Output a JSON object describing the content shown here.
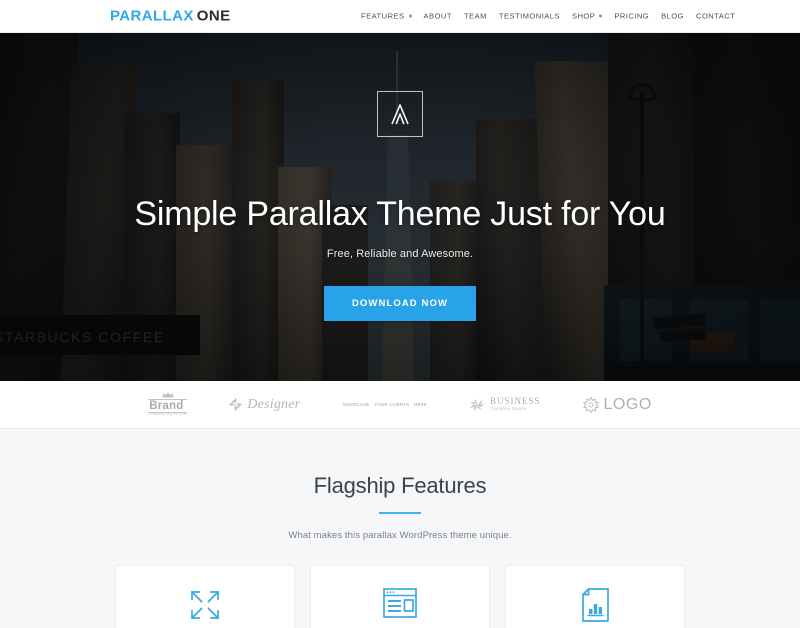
{
  "header": {
    "logo_primary": "PARALLAX",
    "logo_secondary": "ONE",
    "nav": [
      {
        "label": "FEATURES",
        "has_caret": true
      },
      {
        "label": "ABOUT",
        "has_caret": false
      },
      {
        "label": "TEAM",
        "has_caret": false
      },
      {
        "label": "TESTIMONIALS",
        "has_caret": false
      },
      {
        "label": "SHOP",
        "has_caret": true
      },
      {
        "label": "PRICING",
        "has_caret": false
      },
      {
        "label": "BLOG",
        "has_caret": false
      },
      {
        "label": "CONTACT",
        "has_caret": false
      }
    ]
  },
  "hero": {
    "badge_icon": "parallax-mark-icon",
    "title": "Simple Parallax Theme Just for You",
    "subtitle": "Free, Reliable and Awesome.",
    "button_label": "DOWNLOAD NOW",
    "button_color": "#28a3e8",
    "background_text": "STARBUCKS COFFEE"
  },
  "clients": [
    {
      "name": "Brand",
      "tagline": "Company tagline here",
      "icon": "crown-icon"
    },
    {
      "name": "Designer",
      "tagline": "",
      "icon": "flower-star-icon"
    },
    {
      "line1": "SHOWCASE",
      "line2": "YOUR CLIENTS",
      "line3": "HERE"
    },
    {
      "name": "BUSINESS",
      "tagline": "Company Slogan",
      "icon": "leaf-icon"
    },
    {
      "name": "LOGO",
      "tagline": "",
      "icon": "starburst-icon"
    }
  ],
  "features": {
    "title": "Flagship Features",
    "rule_color": "#40b3e8",
    "subtitle": "What makes this parallax WordPress theme unique.",
    "cards": [
      {
        "icon": "expand-arrows-icon"
      },
      {
        "icon": "browser-layout-icon"
      },
      {
        "icon": "document-chart-icon"
      }
    ]
  }
}
